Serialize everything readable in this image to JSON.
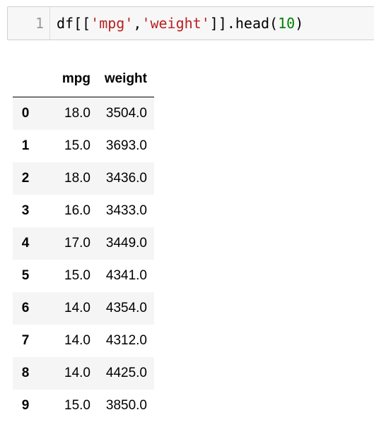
{
  "code_cell": {
    "line_number": "1",
    "tokens": {
      "prefix": "df[[",
      "str1": "'mpg'",
      "comma": ",",
      "str2": "'weight'",
      "method": "]].head(",
      "arg": "10",
      "close": ")"
    }
  },
  "output": {
    "columns": [
      "mpg",
      "weight"
    ],
    "rows": [
      {
        "index": "0",
        "mpg": "18.0",
        "weight": "3504.0"
      },
      {
        "index": "1",
        "mpg": "15.0",
        "weight": "3693.0"
      },
      {
        "index": "2",
        "mpg": "18.0",
        "weight": "3436.0"
      },
      {
        "index": "3",
        "mpg": "16.0",
        "weight": "3433.0"
      },
      {
        "index": "4",
        "mpg": "17.0",
        "weight": "3449.0"
      },
      {
        "index": "5",
        "mpg": "15.0",
        "weight": "4341.0"
      },
      {
        "index": "6",
        "mpg": "14.0",
        "weight": "4354.0"
      },
      {
        "index": "7",
        "mpg": "14.0",
        "weight": "4312.0"
      },
      {
        "index": "8",
        "mpg": "14.0",
        "weight": "4425.0"
      },
      {
        "index": "9",
        "mpg": "15.0",
        "weight": "3850.0"
      }
    ]
  },
  "colors": {
    "string": "#ba2121",
    "number": "#008000",
    "cell_background": "#f7f7f7",
    "row_stripe": "#f5f5f5"
  }
}
